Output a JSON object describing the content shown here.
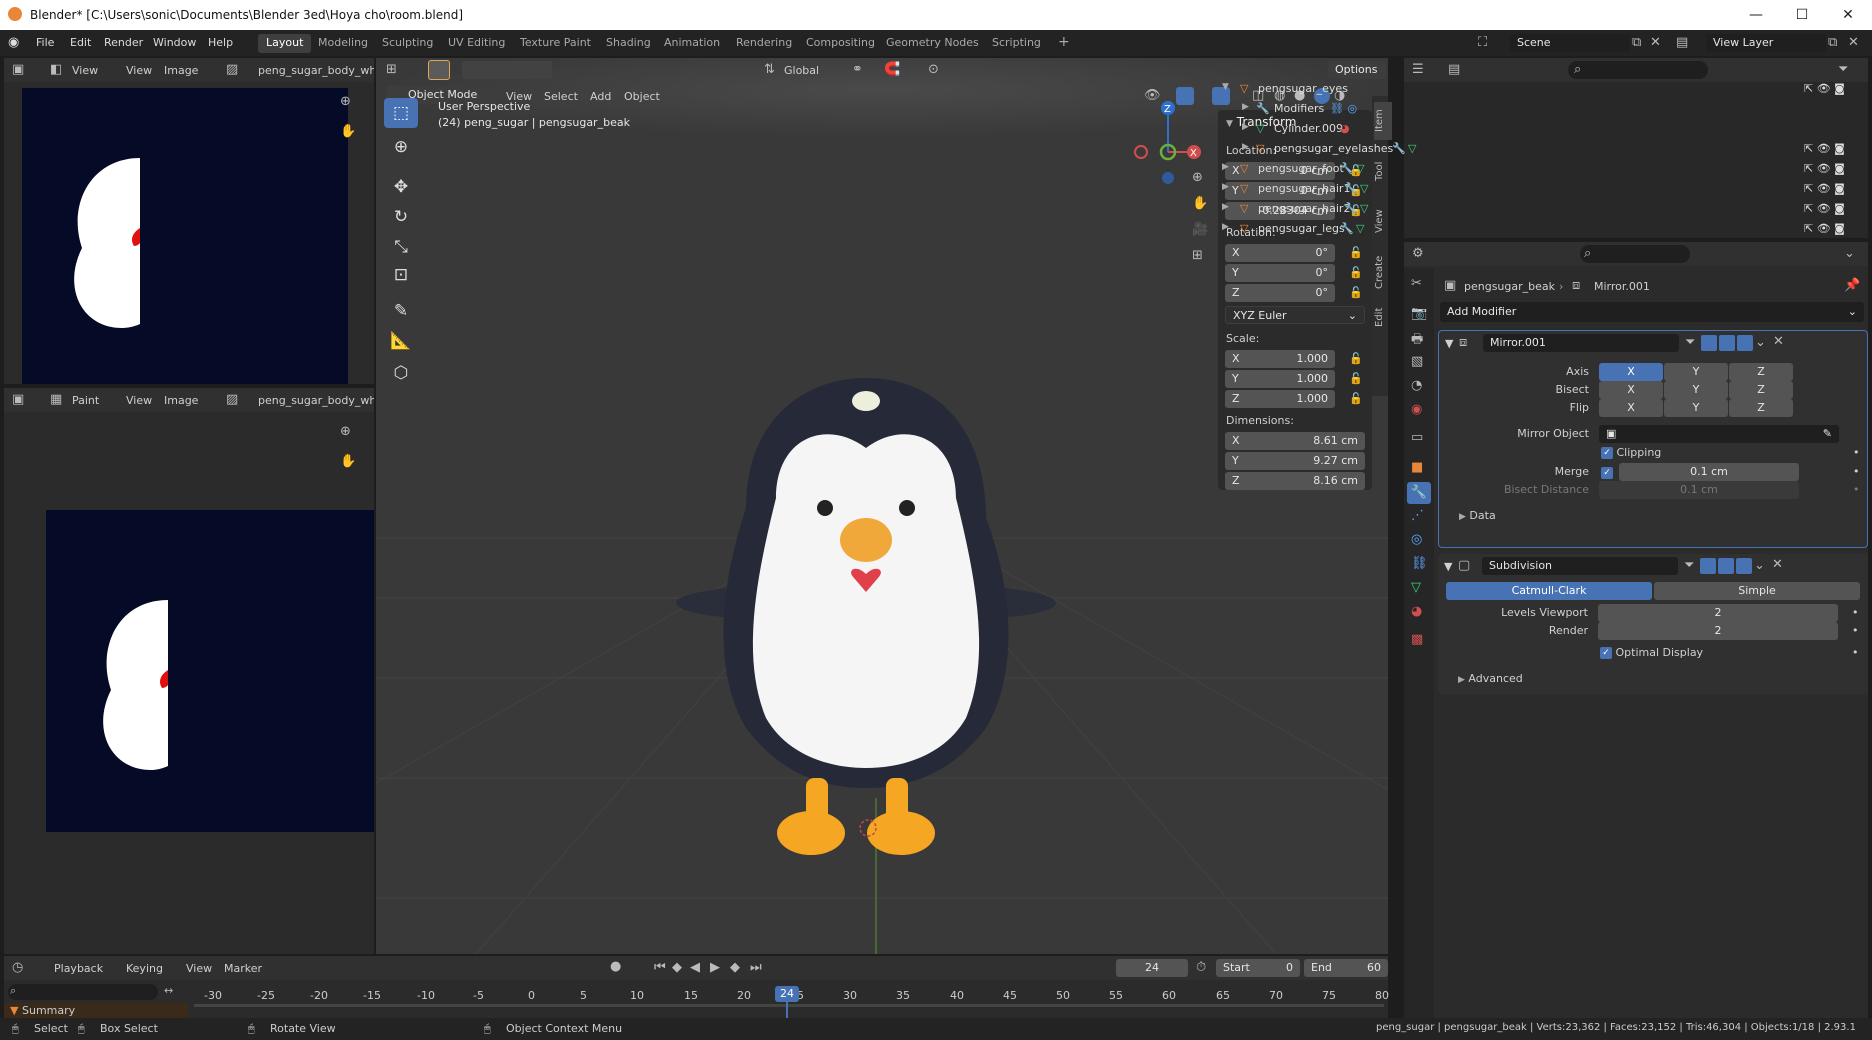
{
  "window": {
    "title": "Blender* [C:\\Users\\sonic\\Documents\\Blender 3ed\\Hoya cho\\room.blend]"
  },
  "menus": [
    "File",
    "Edit",
    "Render",
    "Window",
    "Help"
  ],
  "workspaces": [
    "Layout",
    "Modeling",
    "Sculpting",
    "UV Editing",
    "Texture Paint",
    "Shading",
    "Animation",
    "Rendering",
    "Compositing",
    "Geometry Nodes",
    "Scripting"
  ],
  "scene": {
    "name": "Scene",
    "view_layer": "View Layer"
  },
  "image_editor_top": {
    "view_mode": "View",
    "view": "View",
    "image": "Image",
    "image_name": "peng_sugar_body_whit"
  },
  "image_editor_bottom": {
    "mode": "Paint",
    "view": "View",
    "image": "Image",
    "image_name": "peng_sugar_body_whit"
  },
  "viewport": {
    "mode": "Object Mode",
    "menus": [
      "View",
      "Select",
      "Add",
      "Object"
    ],
    "orientation": "Global",
    "options": "Options",
    "info_line1": "User Perspective",
    "info_line2": "(24) peng_sugar | pengsugar_beak",
    "tabs": [
      "Item",
      "Tool",
      "View",
      "Create",
      "Edit"
    ],
    "axis": {
      "x": "X",
      "y": "Y",
      "z": "Z"
    }
  },
  "transform": {
    "title": "Transform",
    "location_label": "Location:",
    "location": [
      {
        "axis": "X",
        "value": "0 cm"
      },
      {
        "axis": "Y",
        "value": "0 cm"
      },
      {
        "axis": "",
        "value": "-0.28304 cm"
      }
    ],
    "rotation_label": "Rotation:",
    "rotation": [
      {
        "axis": "X",
        "value": "0°"
      },
      {
        "axis": "Y",
        "value": "0°"
      },
      {
        "axis": "Z",
        "value": "0°"
      }
    ],
    "rotation_mode": "XYZ Euler",
    "scale_label": "Scale:",
    "scale": [
      {
        "axis": "X",
        "value": "1.000"
      },
      {
        "axis": "Y",
        "value": "1.000"
      },
      {
        "axis": "Z",
        "value": "1.000"
      }
    ],
    "dimensions_label": "Dimensions:",
    "dimensions": [
      {
        "axis": "X",
        "value": "8.61 cm"
      },
      {
        "axis": "Y",
        "value": "9.27 cm"
      },
      {
        "axis": "Z",
        "value": "8.16 cm"
      }
    ]
  },
  "outliner": {
    "items": [
      {
        "name": "pengsugar_eyes",
        "indent": 1
      },
      {
        "name": "Modifiers",
        "indent": 2
      },
      {
        "name": "Cylinder.009",
        "indent": 2
      },
      {
        "name": "pengsugar_eyelashes",
        "indent": 2
      },
      {
        "name": "pengsugar_foot",
        "indent": 1
      },
      {
        "name": "pengsugar_hair1",
        "indent": 1
      },
      {
        "name": "pengsugar_hair2",
        "indent": 1
      },
      {
        "name": "pengsugar_legs",
        "indent": 1
      }
    ]
  },
  "properties": {
    "object": "pengsugar_beak",
    "modifier_crumb": "Mirror.001",
    "add_modifier": "Add Modifier",
    "mirror": {
      "name": "Mirror.001",
      "axis_label": "Axis",
      "bisect_label": "Bisect",
      "flip_label": "Flip",
      "x": "X",
      "y": "Y",
      "z": "Z",
      "mirror_object_label": "Mirror Object",
      "clipping": "Clipping",
      "merge_label": "Merge",
      "merge_value": "0.1 cm",
      "bisect_distance_label": "Bisect Distance",
      "bisect_distance_value": "0.1 cm",
      "data": "Data"
    },
    "subdivision": {
      "name": "Subdivision",
      "catmull": "Catmull-Clark",
      "simple": "Simple",
      "levels_label": "Levels Viewport",
      "levels_value": "2",
      "render_label": "Render",
      "render_value": "2",
      "optimal": "Optimal Display",
      "advanced": "Advanced"
    }
  },
  "timeline": {
    "playback": "Playback",
    "keying": "Keying",
    "view": "View",
    "marker": "Marker",
    "current_frame": "24",
    "start_label": "Start",
    "start": "0",
    "end_label": "End",
    "end": "60",
    "ticks": [
      "-30",
      "-25",
      "-20",
      "-15",
      "-10",
      "-5",
      "0",
      "5",
      "10",
      "15",
      "20",
      "25",
      "30",
      "35",
      "40",
      "45",
      "50",
      "55",
      "60",
      "65",
      "70",
      "75",
      "80"
    ],
    "summary": "Summary"
  },
  "status": {
    "select": "Select",
    "box_select": "Box Select",
    "rotate_view": "Rotate View",
    "context_menu": "Object Context Menu",
    "stats": "peng_sugar | pengsugar_beak | Verts:23,362 | Faces:23,152 | Tris:46,304 | Objects:1/18 | 2.93.1"
  }
}
